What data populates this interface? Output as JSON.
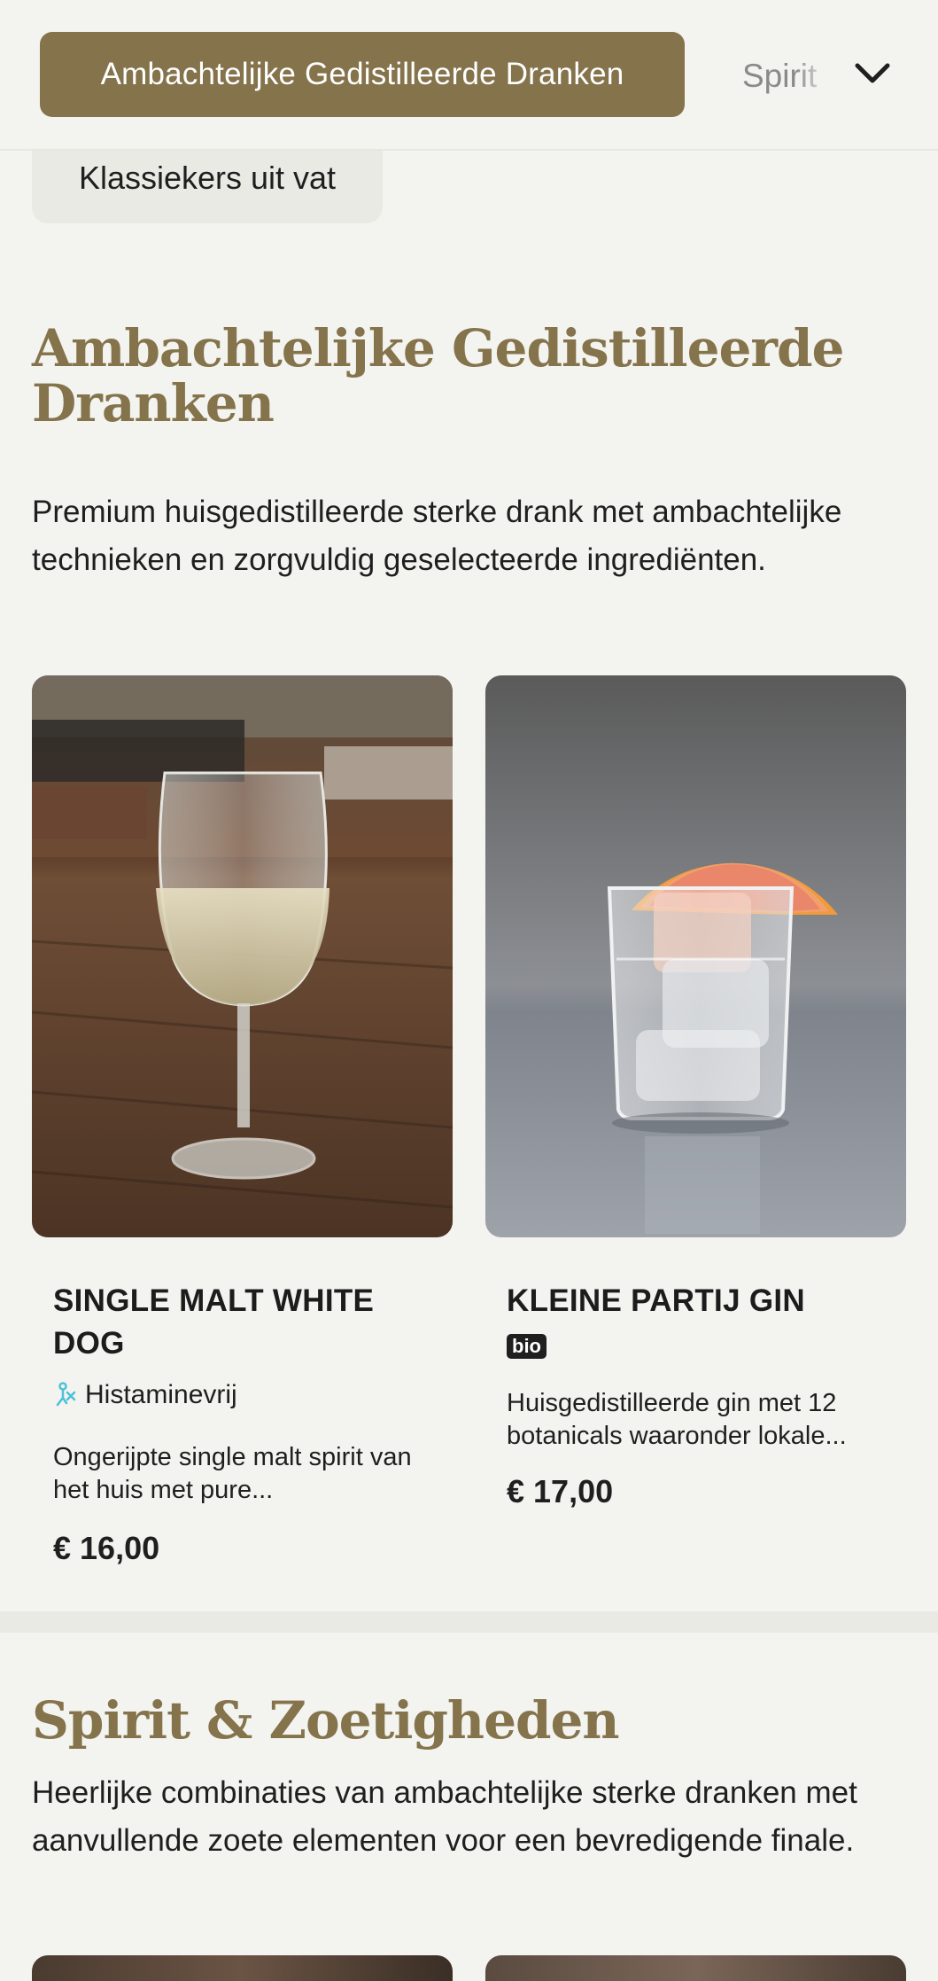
{
  "nav": {
    "active_category": "Ambachtelijke Gedistilleerde Dranken",
    "next_category": "Spirit",
    "chevron_icon": "chevron-down-icon"
  },
  "subcategory_pill": "Klassiekers uit vat",
  "sections": [
    {
      "title": "Ambachtelijke Gedistilleerde Dranken",
      "description": "Premium huisgedistilleerde sterke drank met ambachtelijke technieken en zorgvuldig geselecteerde ingrediënten.",
      "products": [
        {
          "name": "SINGLE MALT WHITE DOG",
          "tag": "Histaminevrij",
          "tag_icon": "histamine-free-icon",
          "description": "Ongerijpte single malt spirit van het huis met pure...",
          "price": "€ 16,00"
        },
        {
          "name": "KLEINE PARTIJ GIN",
          "badge": "bio",
          "description": "Huisgedistilleerde gin met 12 botanicals waaronder lokale...",
          "price": "€ 17,00"
        }
      ]
    },
    {
      "title": "Spirit & Zoetigheden",
      "description": "Heerlijke combinaties van ambachtelijke sterke dranken met aanvullende zoete elementen voor een bevredigende finale."
    }
  ],
  "colors": {
    "accent": "#84734b",
    "background": "#f3f3ef",
    "text": "#1f1f1f"
  }
}
